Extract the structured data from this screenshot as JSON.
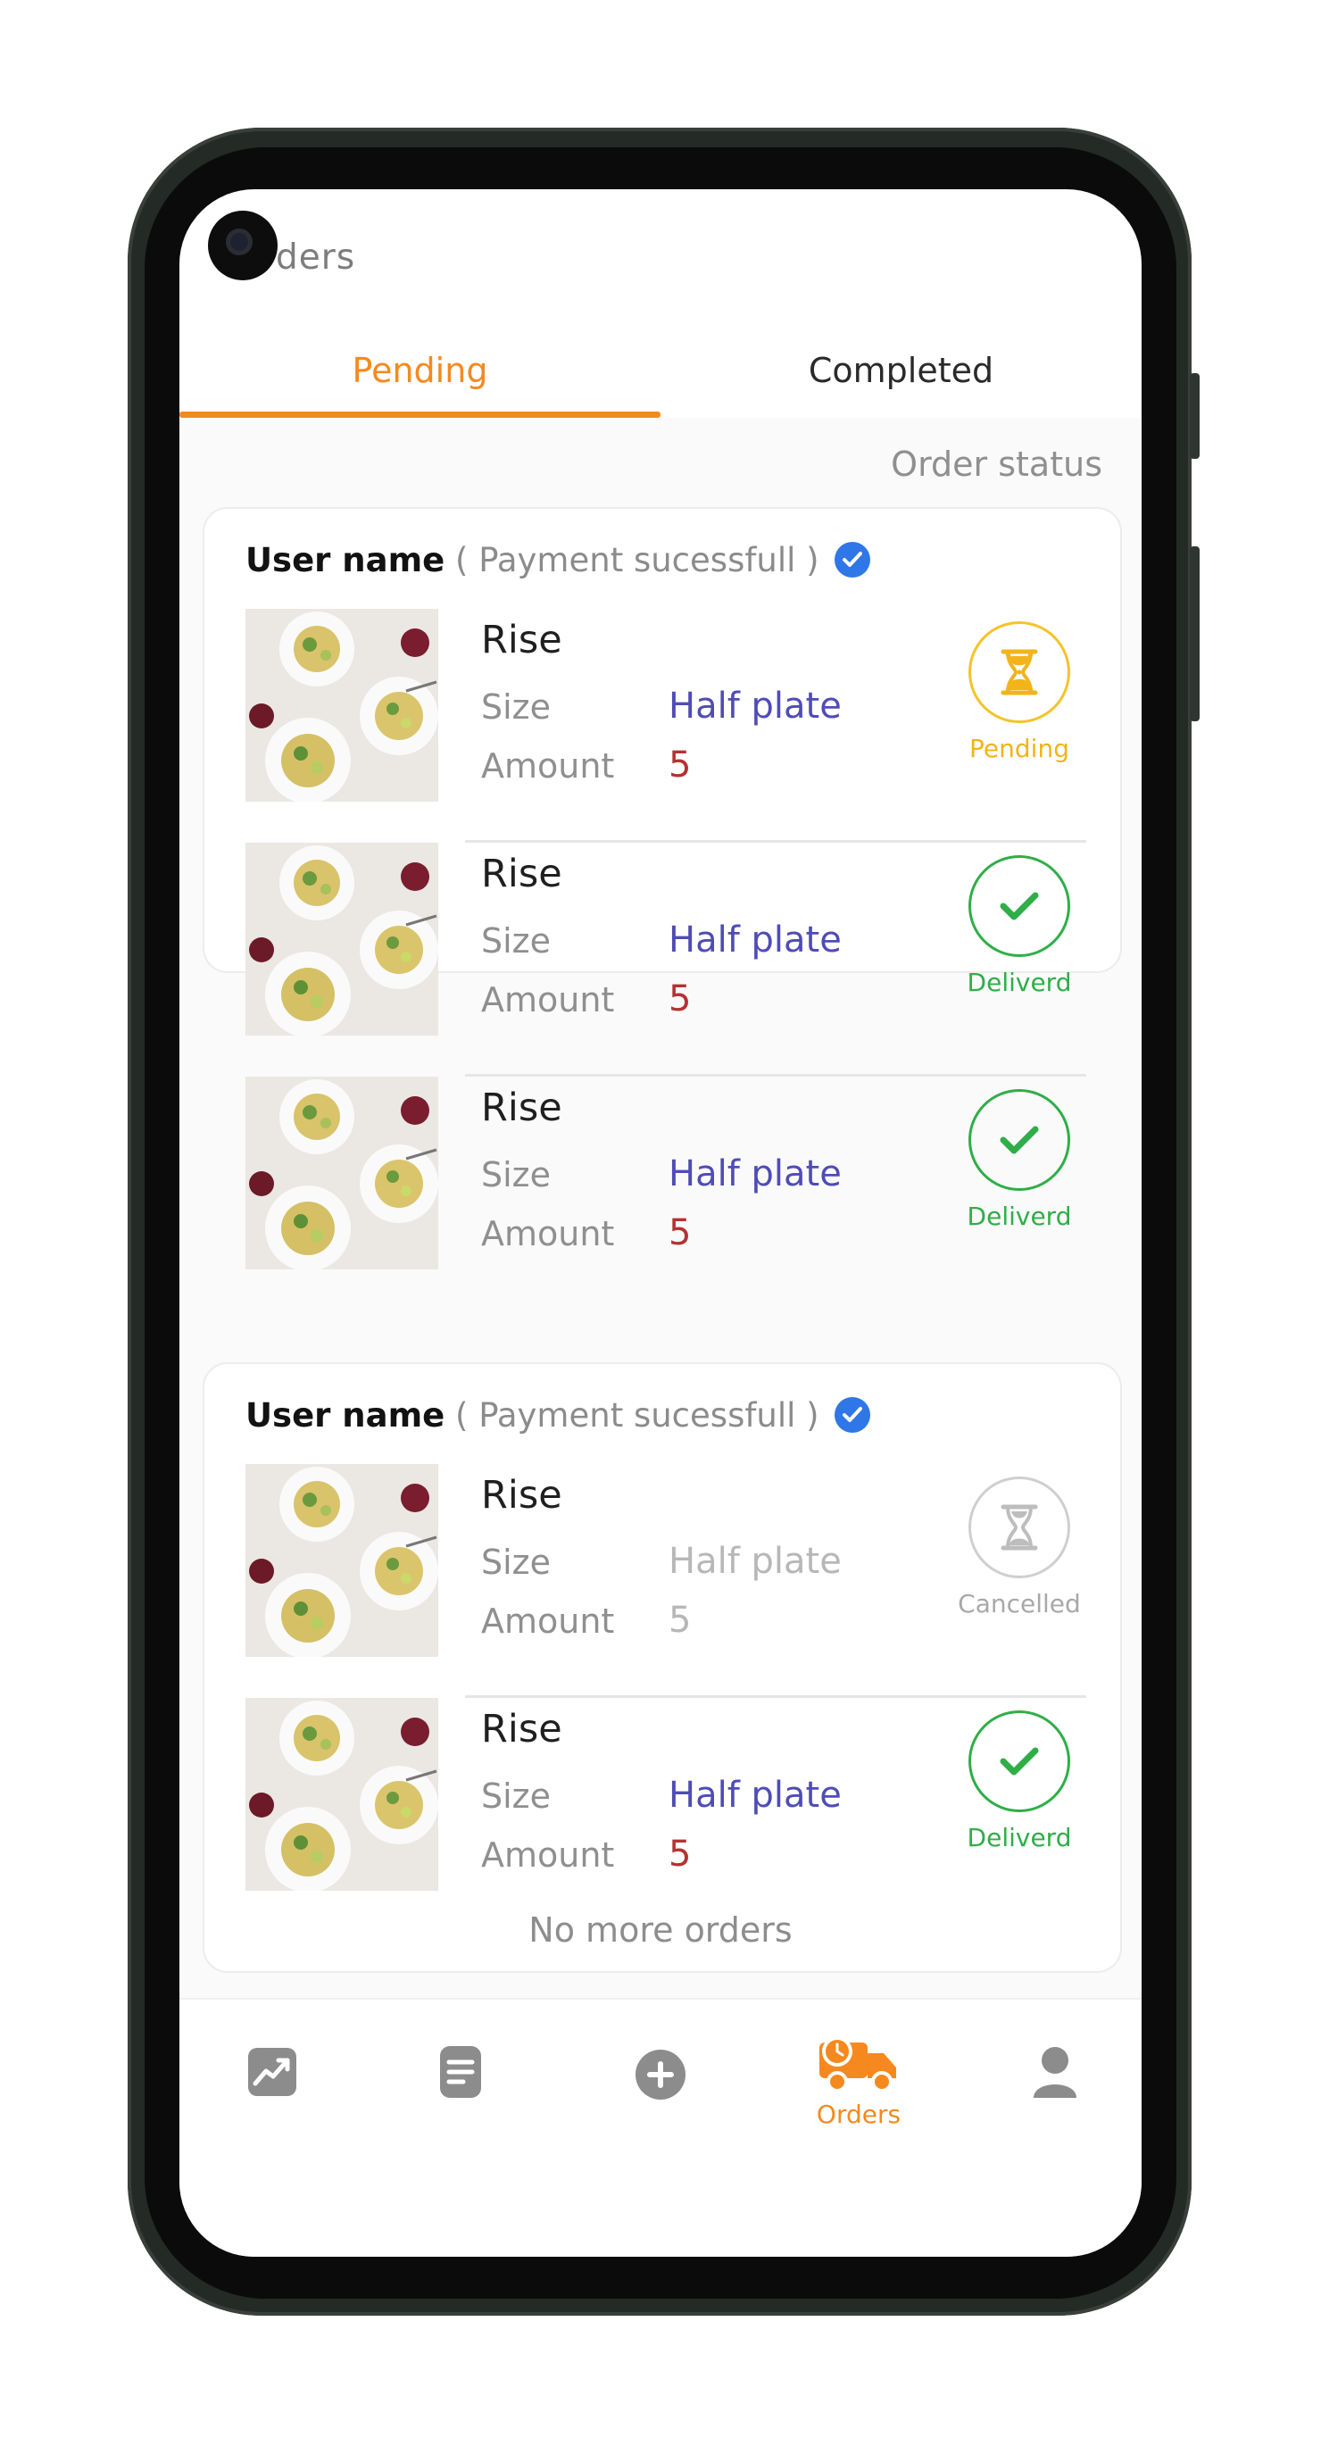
{
  "header": {
    "title": "Orders"
  },
  "tabs": [
    {
      "label": "Pending",
      "active": true
    },
    {
      "label": "Completed",
      "active": false
    }
  ],
  "order_status_label": "Order status",
  "orders": [
    {
      "user_name": "User name",
      "payment_status": "( Payment sucessfull )",
      "items": [
        {
          "name": "Rise",
          "size_label": "Size",
          "size_value": "Half plate",
          "amount_label": "Amount",
          "amount_value": "5",
          "status": "Pending"
        },
        {
          "name": "Rise",
          "size_label": "Size",
          "size_value": "Half plate",
          "amount_label": "Amount",
          "amount_value": "5",
          "status": "Deliverd"
        },
        {
          "name": "Rise",
          "size_label": "Size",
          "size_value": "Half plate",
          "amount_label": "Amount",
          "amount_value": "5",
          "status": "Deliverd"
        }
      ]
    },
    {
      "user_name": "User name",
      "payment_status": "( Payment sucessfull )",
      "items": [
        {
          "name": "Rise",
          "size_label": "Size",
          "size_value": "Half plate",
          "amount_label": "Amount",
          "amount_value": "5",
          "status": "Cancelled"
        },
        {
          "name": "Rise",
          "size_label": "Size",
          "size_value": "Half plate",
          "amount_label": "Amount",
          "amount_value": "5",
          "status": "Deliverd"
        }
      ]
    }
  ],
  "no_more_orders": "No more orders",
  "bottom_nav": [
    {
      "icon": "chart-icon",
      "label": ""
    },
    {
      "icon": "list-icon",
      "label": ""
    },
    {
      "icon": "add-icon",
      "label": ""
    },
    {
      "icon": "delivery-truck-icon",
      "label": "Orders",
      "active": true
    },
    {
      "icon": "user-icon",
      "label": ""
    }
  ],
  "colors": {
    "accent": "#f5891f",
    "pending": "#f5c32a",
    "delivered": "#2fae48",
    "cancelled": "#cfcfcf",
    "size_value": "#4f4cb7",
    "amount_value": "#b43232",
    "verified": "#2f76e8"
  }
}
